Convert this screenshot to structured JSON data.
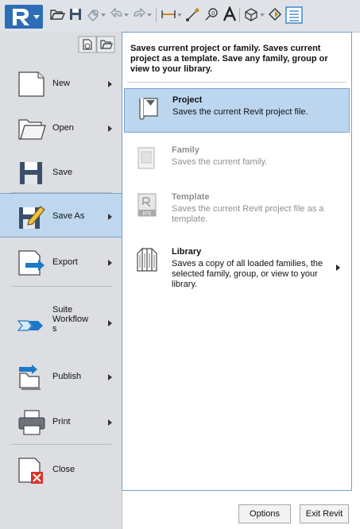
{
  "menu": {
    "commands": [
      {
        "id": "new",
        "label": "New",
        "arrow": true
      },
      {
        "id": "open",
        "label": "Open",
        "arrow": true
      },
      {
        "id": "save",
        "label": "Save",
        "arrow": false
      },
      {
        "id": "save-as",
        "label": "Save As",
        "arrow": true,
        "selected": true
      },
      {
        "id": "export",
        "label": "Export",
        "arrow": true
      },
      {
        "id": "suite-workflows",
        "label": "Suite\nWorkflow\ns",
        "arrow": true
      },
      {
        "id": "publish",
        "label": "Publish",
        "arrow": true
      },
      {
        "id": "print",
        "label": "Print",
        "arrow": true
      },
      {
        "id": "close",
        "label": "Close",
        "arrow": false
      }
    ]
  },
  "save_as": {
    "description": "Saves current project or family. Saves current project as a template. Save any family, group or view to your library.",
    "options": [
      {
        "title": "Project",
        "desc": "Saves the current Revit project file.",
        "selected": true,
        "enabled": true
      },
      {
        "title": "Family",
        "desc": "Saves the current family.",
        "selected": false,
        "enabled": false
      },
      {
        "title": "Template",
        "desc": "Saves the current Revit project file as a template.",
        "selected": false,
        "enabled": false,
        "icon_text": "RTE"
      },
      {
        "title": "Library",
        "desc": "Saves a copy of all loaded families, the selected family, group, or view to your library.",
        "selected": false,
        "enabled": true,
        "arrow": true
      }
    ]
  },
  "footer": {
    "options_label": "Options",
    "exit_label": "Exit Revit"
  },
  "colors": {
    "accent": "#1e78c8",
    "selected_bg": "#bcd6ef",
    "close_badge": "#d9342b"
  }
}
